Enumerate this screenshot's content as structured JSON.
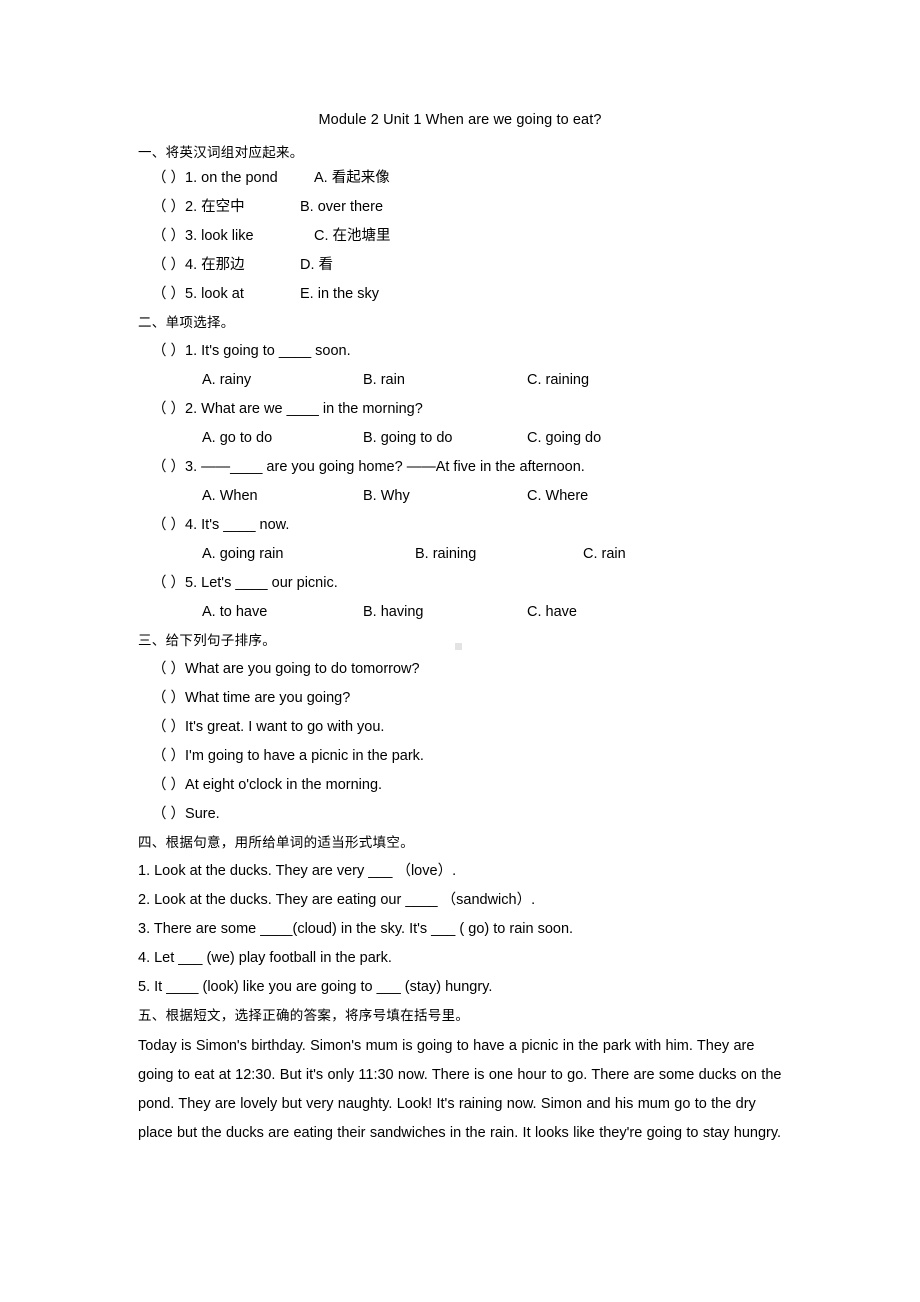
{
  "document": {
    "title": "Module 2 Unit 1 When are we going to eat?"
  },
  "section1": {
    "heading": "一、将英汉词组对应起来。",
    "items": [
      {
        "left": "（ ）1. on the pond",
        "right": "A. 看起来像",
        "right_indent": true
      },
      {
        "left": "（ ）2. 在空中",
        "right": "B. over there",
        "right_indent": false
      },
      {
        "left": "（ ）3. look like",
        "right": "C. 在池塘里",
        "right_indent": true
      },
      {
        "left": "（ ）4. 在那边",
        "right": "D. 看",
        "right_indent": false
      },
      {
        "left": "（ ）5. look at",
        "right": "E. in the sky",
        "right_indent": false
      }
    ]
  },
  "section2": {
    "heading": "二、单项选择。",
    "questions": [
      {
        "stem": "（ ）1. It's going to ____ soon.",
        "a": "A. rainy",
        "b": "B. rain",
        "c": "C. raining",
        "wide": false
      },
      {
        "stem": "（ ）2. What are we ____ in the morning?",
        "a": "A. go to do",
        "b": "B. going to do",
        "c": "C. going do",
        "wide": false
      },
      {
        "stem": "（ ）3. ——____ are you going home?    ——At five in the afternoon.",
        "a": "A. When",
        "b": "B. Why",
        "c": "C. Where",
        "wide": false
      },
      {
        "stem": "（ ）4. It's ____ now.",
        "a": "A. going rain",
        "b": "B. raining",
        "c": "C. rain",
        "wide": true
      },
      {
        "stem": "（ ）5. Let's ____ our picnic.",
        "a": "A. to have",
        "b": "B. having",
        "c": "C. have",
        "wide": false
      }
    ]
  },
  "section3": {
    "heading": "三、给下列句子排序。",
    "items": [
      "（ ）What are you going to do tomorrow?",
      "（ ）What time are you going?",
      "（ ）It's great. I want to go with you.",
      "（ ）I'm going to have a picnic in the park.",
      "（ ）At eight o'clock in the morning.",
      "（ ）Sure."
    ]
  },
  "section4": {
    "heading": "四、根据句意，用所给单词的适当形式填空。",
    "items": [
      "1. Look at the ducks. They are very ___ （love）.",
      "2. Look at the ducks. They are eating our ____ （sandwich）.",
      "3. There are some ____(cloud) in the sky. It's ___ ( go) to rain soon.",
      "4. Let ___ (we) play football in the park.",
      "5. It ____ (look) like you are going to ___ (stay) hungry."
    ]
  },
  "section5": {
    "heading": "五、根据短文，选择正确的答案，将序号填在括号里。",
    "passage": "Today is Simon's birthday. Simon's mum is going to have a picnic in the park with him. They are going to eat at 12:30. But it's only 11:30 now. There is one hour to go. There are some ducks on the pond. They are lovely but very naughty. Look!  It's raining now. Simon and his mum go to the dry place but the ducks are eating their sandwiches in the rain. It looks like they're going to stay hungry."
  }
}
